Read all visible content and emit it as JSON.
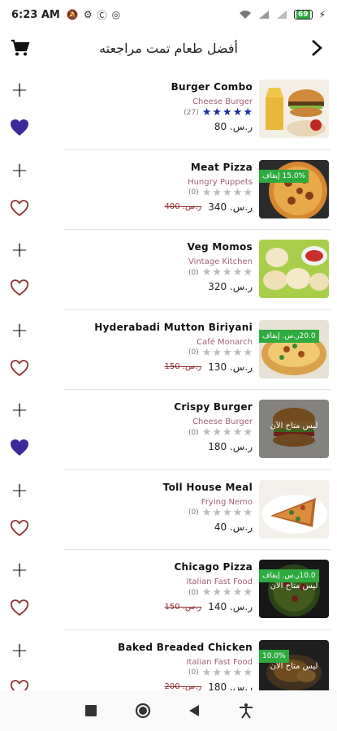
{
  "status_bar": {
    "time": "6:23 AM",
    "battery": "69"
  },
  "app_bar": {
    "title": "أفضل طعام تمت مراجعته"
  },
  "items": [
    {
      "name": "Burger Combo",
      "restaurant": "Cheese Burger",
      "rating_count": "(27)",
      "rating": 5,
      "price": "ر.س. 80",
      "old_price": "",
      "discount": "",
      "closed_label": "",
      "favorite": true,
      "image": "burger-combo"
    },
    {
      "name": "Meat Pizza",
      "restaurant": "Hungry Puppets",
      "rating_count": "(0)",
      "rating": 0,
      "price": "ر.س. 340",
      "old_price": "ر.س. 400",
      "discount": "15.0% إيقاف",
      "closed_label": "",
      "favorite": false,
      "image": "meat-pizza"
    },
    {
      "name": "Veg Momos",
      "restaurant": "Vintage Kitchen",
      "rating_count": "(0)",
      "rating": 0,
      "price": "ر.س. 320",
      "old_price": "",
      "discount": "",
      "closed_label": "",
      "favorite": false,
      "image": "veg-momos"
    },
    {
      "name": "Hyderabadi Mutton Biriyani",
      "restaurant": "Café Monarch",
      "rating_count": "(0)",
      "rating": 0,
      "price": "ر.س. 130",
      "old_price": "ر.س. 150",
      "discount": "20.0ر.س. إيقاف",
      "closed_label": "",
      "favorite": false,
      "image": "biriyani"
    },
    {
      "name": "Crispy Burger",
      "restaurant": "Cheese Burger",
      "rating_count": "(0)",
      "rating": 0,
      "price": "ر.س. 180",
      "old_price": "",
      "discount": "",
      "closed_label": "ليس متاح الآن",
      "favorite": true,
      "image": "crispy-burger"
    },
    {
      "name": "Toll House Meal",
      "restaurant": "Frying Nemo",
      "rating_count": "(0)",
      "rating": 0,
      "price": "ر.س. 40",
      "old_price": "",
      "discount": "",
      "closed_label": "",
      "favorite": false,
      "image": "toll-house-meal"
    },
    {
      "name": "Chicago Pizza",
      "restaurant": "Italian Fast Food",
      "rating_count": "(0)",
      "rating": 0,
      "price": "ر.س. 140",
      "old_price": "ر.س. 150",
      "discount": "10.0ر.س. إيقاف",
      "closed_label": "ليس متاح الآن",
      "favorite": false,
      "image": "chicago-pizza"
    },
    {
      "name": "Baked Breaded Chicken",
      "restaurant": "Italian Fast Food",
      "rating_count": "(0)",
      "rating": 0,
      "price": "ر.س. 180",
      "old_price": "ر.س. 200",
      "discount": "10.0%",
      "closed_label": "ليس متاح الآن",
      "favorite": false,
      "image": "baked-chicken"
    }
  ],
  "colors": {
    "accent": "#3a2a9b",
    "discount_green": "#2eab3f",
    "old_price": "#8b2e2e",
    "restaurant_text": "#a0607a",
    "heart_outline": "#8b2e2e"
  },
  "nav_bar": {
    "buttons": [
      "square-icon",
      "circle-icon",
      "back-triangle-icon",
      "accessibility-icon"
    ]
  }
}
